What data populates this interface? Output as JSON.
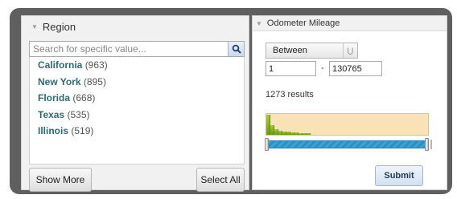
{
  "region": {
    "title": "Region",
    "search_placeholder": "Search for specific value...",
    "items": [
      {
        "name": "California",
        "count": "(963)"
      },
      {
        "name": "New York",
        "count": "(895)"
      },
      {
        "name": "Florida",
        "count": "(668)"
      },
      {
        "name": "Texas",
        "count": "(535)"
      },
      {
        "name": "Illinois",
        "count": "(519)"
      }
    ],
    "show_more_label": "Show More",
    "select_all_label": "Select All"
  },
  "odometer": {
    "title": "Odometer Mileage",
    "operator": "Between",
    "min_value": "1",
    "separator": "-",
    "max_value": "130765",
    "results_text": "1273 results",
    "histogram_levels": [
      0.95,
      0.45,
      0.28,
      0.2,
      0.17,
      0.14,
      0.12,
      0.1,
      0.09,
      0.08,
      0.07
    ],
    "range_fraction": [
      0.0,
      1.0
    ],
    "submit_label": "Submit"
  },
  "colors": {
    "frame": "#5f5f5f",
    "region_name": "#2d6b73",
    "histogram_bg": "#f9e3b6",
    "histogram_bar": "#8dbb1e",
    "slider": "#36a4da"
  }
}
